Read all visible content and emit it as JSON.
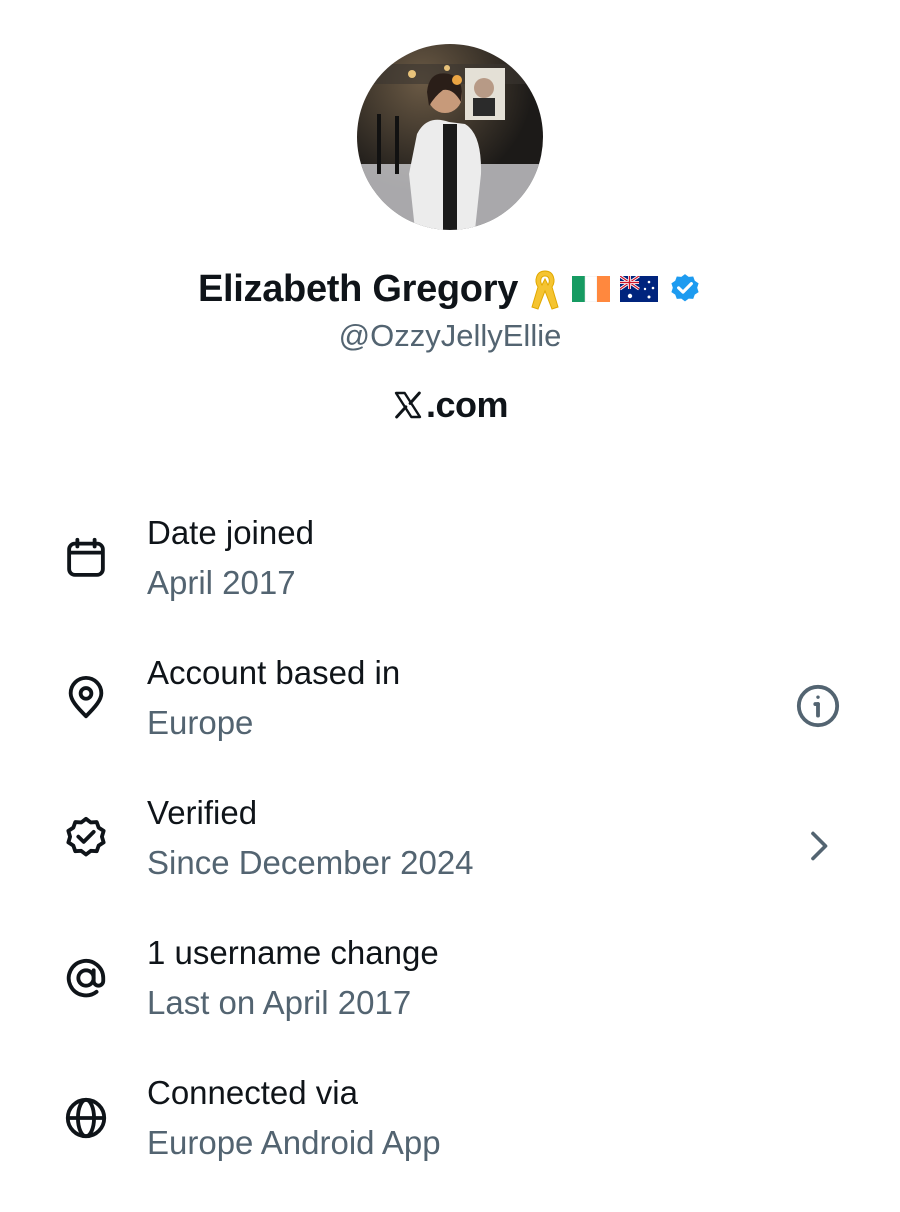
{
  "profile": {
    "display_name": "Elizabeth Gregory",
    "handle": "@OzzyJellyEllie",
    "website": ".com",
    "badges": [
      "yellow-ribbon-icon",
      "ireland-flag-icon",
      "australia-flag-icon",
      "verified-badge-icon"
    ]
  },
  "colors": {
    "text_primary": "#0f1419",
    "text_secondary": "#536471",
    "verified_blue": "#1d9bf0",
    "background": "#ffffff"
  },
  "about": {
    "items": [
      {
        "icon": "calendar-icon",
        "title": "Date joined",
        "value": "April 2017"
      },
      {
        "icon": "location-pin-icon",
        "title": "Account based in",
        "value": "Europe",
        "action_icon": "info-icon"
      },
      {
        "icon": "verified-outline-icon",
        "title": "Verified",
        "value": "Since December 2024",
        "action_icon": "chevron-right-icon"
      },
      {
        "icon": "at-sign-icon",
        "title": "1 username change",
        "value": "Last on April 2017"
      },
      {
        "icon": "globe-icon",
        "title": "Connected via",
        "value": "Europe Android App"
      }
    ]
  }
}
